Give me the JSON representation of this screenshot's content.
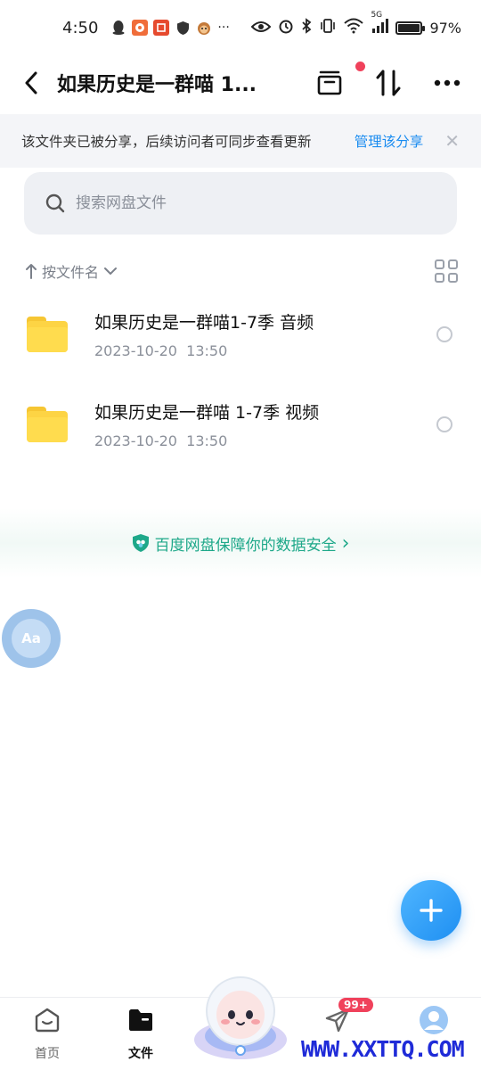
{
  "status_bar": {
    "time": "4:50",
    "battery": "97%",
    "battery_level": 0.97,
    "network": "5G",
    "left_icons": [
      "qq-icon",
      "app-icon",
      "listen-icon",
      "shield-icon",
      "monkey-icon"
    ],
    "more": "···"
  },
  "header": {
    "title": "如果历史是一群喵 1..."
  },
  "share_banner": {
    "text": "该文件夹已被分享，后续访问者可同步查看更新",
    "link": "管理该分享",
    "close": "✕"
  },
  "search": {
    "placeholder": "搜索网盘文件"
  },
  "sort": {
    "label": "按文件名"
  },
  "files": [
    {
      "name": "如果历史是一群喵1-7季 音频",
      "date": "2023-10-20  13:50"
    },
    {
      "name": "如果历史是一群喵 1-7季 视频",
      "date": "2023-10-20  13:50"
    }
  ],
  "safety_banner": {
    "text": "百度网盘保障你的数据安全",
    "arrow": "›"
  },
  "translate_button": {
    "label": "Aa"
  },
  "bottom_nav": {
    "items": [
      {
        "label": "首页",
        "icon": "home-icon"
      },
      {
        "label": "文件",
        "icon": "folder-icon"
      },
      {
        "label": "",
        "icon": "mascot-icon"
      },
      {
        "label": "",
        "icon": "send-icon",
        "badge": "99+"
      },
      {
        "label": "",
        "icon": "profile-icon"
      }
    ]
  },
  "watermark": "WWW.XXTTQ.COM",
  "colors": {
    "accent": "#1a8cf0",
    "badge": "#f0415b",
    "folder": "#fdd444",
    "safety": "#1ea889"
  }
}
